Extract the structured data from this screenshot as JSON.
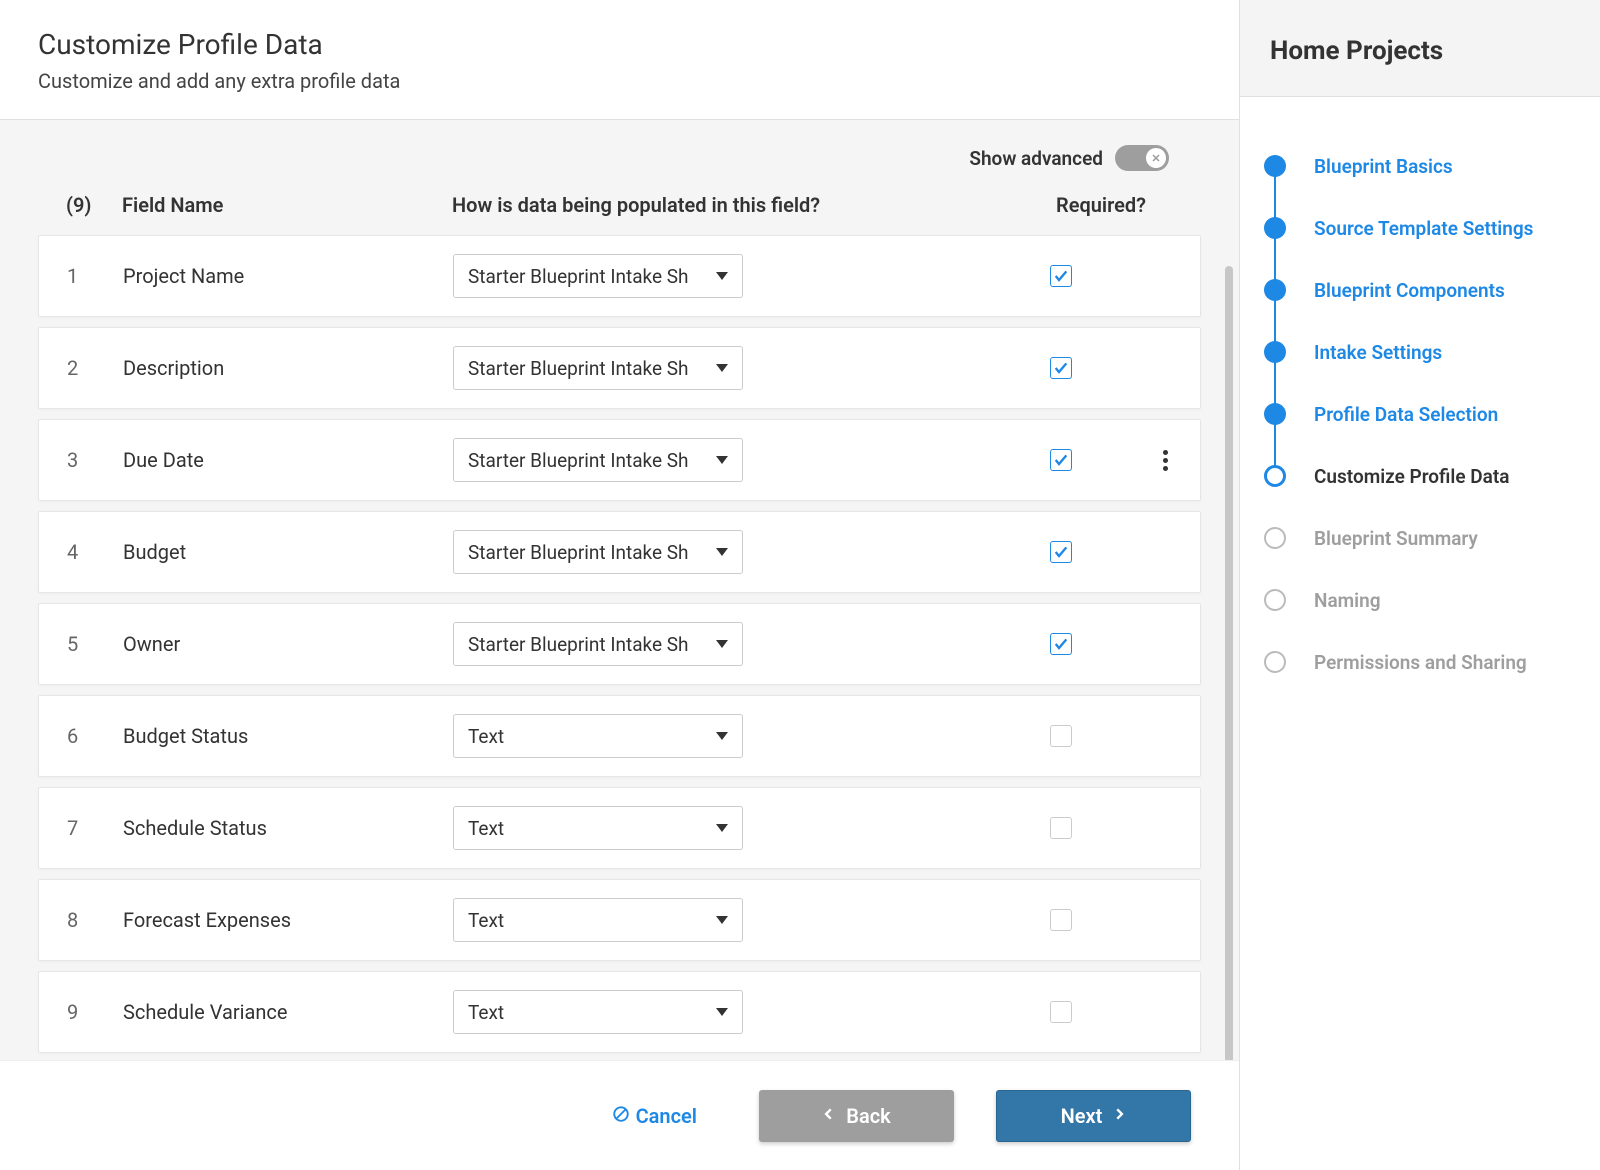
{
  "header": {
    "title": "Customize Profile Data",
    "subtitle": "Customize and add any extra profile data"
  },
  "advanced": {
    "label": "Show advanced"
  },
  "table": {
    "count": "(9)",
    "headers": {
      "name": "Field Name",
      "populated": "How is data being populated in this field?",
      "required": "Required?"
    }
  },
  "rows": [
    {
      "num": "1",
      "name": "Project Name",
      "pop": "Starter Blueprint Intake Sh",
      "required": true,
      "menu": false
    },
    {
      "num": "2",
      "name": "Description",
      "pop": "Starter Blueprint Intake Sh",
      "required": true,
      "menu": false
    },
    {
      "num": "3",
      "name": "Due Date",
      "pop": "Starter Blueprint Intake Sh",
      "required": true,
      "menu": true
    },
    {
      "num": "4",
      "name": "Budget",
      "pop": "Starter Blueprint Intake Sh",
      "required": true,
      "menu": false
    },
    {
      "num": "5",
      "name": "Owner",
      "pop": "Starter Blueprint Intake Sh",
      "required": true,
      "menu": false
    },
    {
      "num": "6",
      "name": "Budget Status",
      "pop": "Text",
      "required": false,
      "menu": false
    },
    {
      "num": "7",
      "name": "Schedule Status",
      "pop": "Text",
      "required": false,
      "menu": false
    },
    {
      "num": "8",
      "name": "Forecast Expenses",
      "pop": "Text",
      "required": false,
      "menu": false
    },
    {
      "num": "9",
      "name": "Schedule Variance",
      "pop": "Text",
      "required": false,
      "menu": false
    }
  ],
  "footer": {
    "cancel": "Cancel",
    "back": "Back",
    "next": "Next"
  },
  "sidebar": {
    "title": "Home Projects",
    "steps": [
      {
        "label": "Blueprint Basics",
        "state": "done"
      },
      {
        "label": "Source Template Settings",
        "state": "done"
      },
      {
        "label": "Blueprint Components",
        "state": "done"
      },
      {
        "label": "Intake Settings",
        "state": "done"
      },
      {
        "label": "Profile Data Selection",
        "state": "done"
      },
      {
        "label": "Customize Profile Data",
        "state": "current"
      },
      {
        "label": "Blueprint Summary",
        "state": "pending"
      },
      {
        "label": "Naming",
        "state": "pending"
      },
      {
        "label": "Permissions and Sharing",
        "state": "pending"
      }
    ]
  }
}
